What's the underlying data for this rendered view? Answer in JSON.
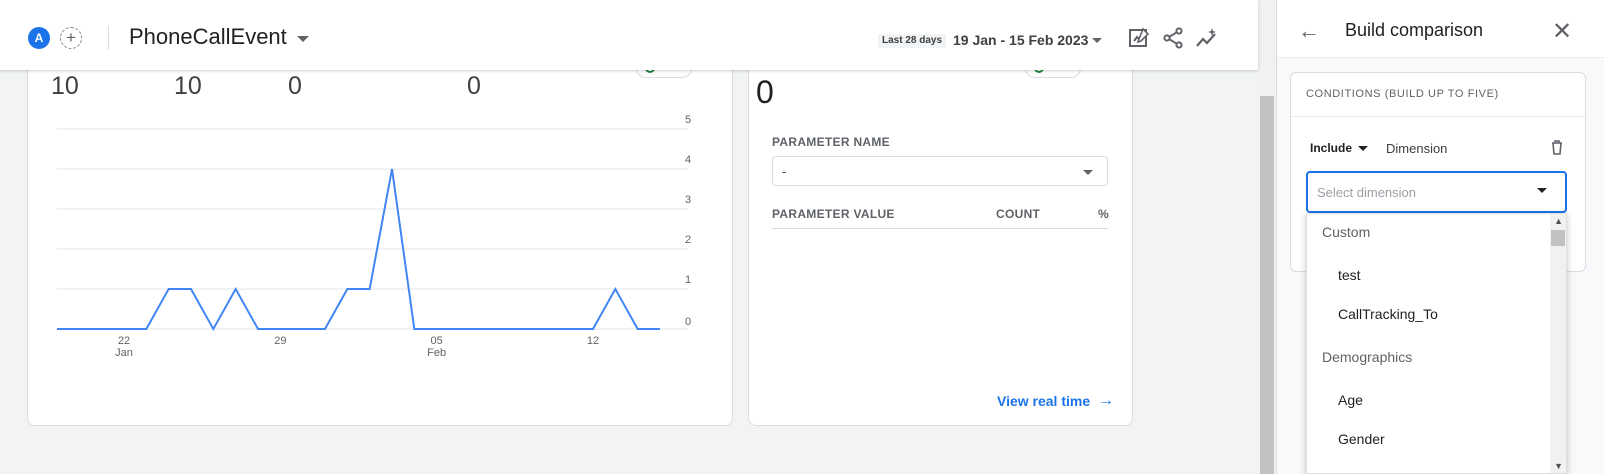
{
  "header": {
    "avatar_letter": "A",
    "add_symbol": "+",
    "title": "PhoneCallEvent",
    "range_chip": "Last 28 days",
    "date_range": "19 Jan - 15 Feb 2023",
    "icons": [
      "customize-report-icon",
      "share-icon",
      "insights-icon"
    ]
  },
  "left_card": {
    "metrics": [
      "10",
      "10",
      "0",
      "0"
    ]
  },
  "chart_data": {
    "type": "line",
    "x": [
      "19 Jan",
      "20 Jan",
      "21 Jan",
      "22 Jan",
      "23 Jan",
      "24 Jan",
      "25 Jan",
      "26 Jan",
      "27 Jan",
      "28 Jan",
      "29 Jan",
      "30 Jan",
      "31 Jan",
      "1 Feb",
      "2 Feb",
      "3 Feb",
      "4 Feb",
      "5 Feb",
      "6 Feb",
      "7 Feb",
      "8 Feb",
      "9 Feb",
      "10 Feb",
      "11 Feb",
      "12 Feb",
      "13 Feb",
      "14 Feb",
      "15 Feb"
    ],
    "series": [
      {
        "values": [
          0,
          0,
          0,
          0,
          0,
          1,
          1,
          0,
          1,
          0,
          0,
          0,
          0,
          1,
          1,
          4,
          0,
          0,
          0,
          0,
          0,
          0,
          0,
          0,
          0,
          1,
          0,
          0
        ],
        "color": "#4285f4"
      }
    ],
    "yticks": [
      "0",
      "1",
      "2",
      "3",
      "4",
      "5"
    ],
    "ylim": [
      0,
      5
    ],
    "xticks": [
      {
        "label": "22",
        "sub": "Jan",
        "index": 3
      },
      {
        "label": "29",
        "sub": "",
        "index": 10
      },
      {
        "label": "05",
        "sub": "Feb",
        "index": 17
      },
      {
        "label": "12",
        "sub": "",
        "index": 24
      }
    ],
    "grid": true
  },
  "right_card": {
    "metric": "0",
    "parameter_name_label": "PARAMETER NAME",
    "parameter_select_value": "-",
    "table_headers": [
      "PARAMETER VALUE",
      "COUNT",
      "%"
    ],
    "view_realtime": "View real time",
    "arrow": "→"
  },
  "panel": {
    "back": "←",
    "title": "Build comparison",
    "close": "✕",
    "conditions_title": "CONDITIONS (BUILD UP TO FIVE)",
    "include_label": "Include",
    "dimension_label": "Dimension",
    "dimension_placeholder": "Select dimension",
    "dropdown": {
      "groups": [
        {
          "label": "Custom",
          "items": [
            "test",
            "CallTracking_To"
          ]
        },
        {
          "label": "Demographics",
          "items": [
            "Age",
            "Gender"
          ]
        }
      ]
    }
  }
}
